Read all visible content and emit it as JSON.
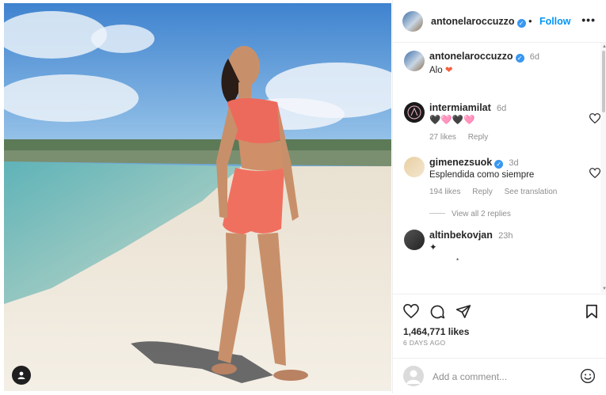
{
  "post": {
    "author": "antonelaroccuzzo",
    "follow_label": "Follow",
    "more_label": "•••",
    "caption": {
      "username": "antonelaroccuzzo",
      "time": "6d",
      "text": "Alo"
    },
    "image_alt": "Woman in coral outfit standing on a sandy beach"
  },
  "comments": [
    {
      "username": "intermiamilat",
      "time": "6d",
      "text": "🖤🩷🖤🩷",
      "likes": "27 likes",
      "reply": "Reply"
    },
    {
      "username": "gimenezsuok",
      "verified": true,
      "time": "3d",
      "text": "Esplendida como siempre",
      "likes": "194 likes",
      "reply": "Reply",
      "translate": "See translation",
      "view_replies": "View all 2 replies"
    },
    {
      "username": "altinbekovjan",
      "time": "23h",
      "text": "✦"
    }
  ],
  "footer": {
    "likes": "1,464,771 likes",
    "ago": "6 DAYS AGO",
    "add_comment_placeholder": "Add a comment..."
  },
  "colors": {
    "accent": "#0095f6",
    "verified": "#3897f0",
    "heart_emoji": "#f56040"
  }
}
